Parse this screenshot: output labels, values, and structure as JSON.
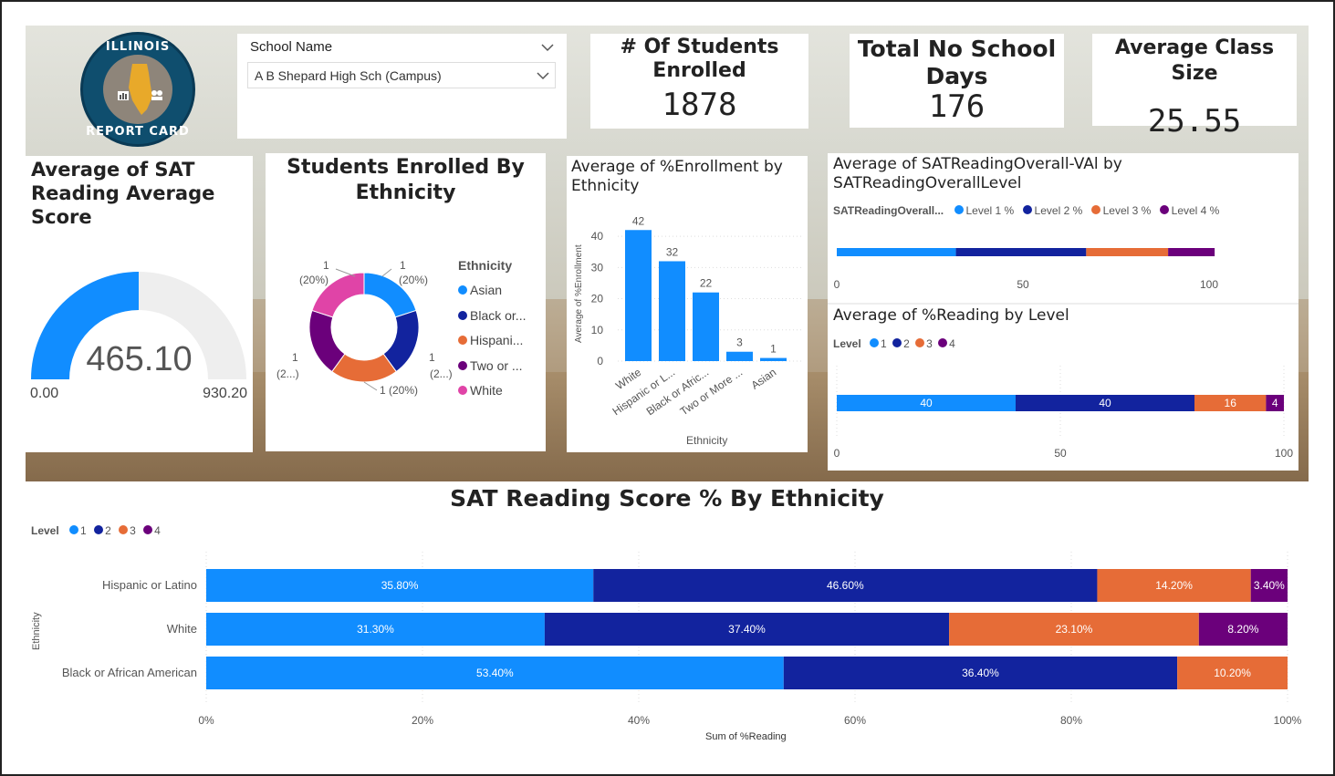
{
  "logo": {
    "top_text": "ILLINOIS",
    "bottom_text": "REPORT CARD"
  },
  "school_filter": {
    "label": "School Name",
    "selected": "A B Shepard High Sch (Campus)"
  },
  "kpis": {
    "students_enrolled": {
      "title_line1": "# Of Students",
      "title_line2": "Enrolled",
      "value": "1878"
    },
    "no_school_days": {
      "title_line1": "Total No School",
      "title_line2": "Days",
      "value": "176"
    },
    "class_size": {
      "title": "Average Class Size",
      "value": "25.55"
    }
  },
  "gauge": {
    "title_line1": "Average of SAT",
    "title_line2": "Reading Average",
    "title_line3": "Score",
    "value_label": "465.10",
    "min_label": "0.00",
    "max_label": "930.20",
    "value": 465.1,
    "min": 0,
    "max": 930.2,
    "color": "#118DFF"
  },
  "donut": {
    "title_line1": "Students Enrolled By",
    "title_line2": "Ethnicity",
    "legend_title": "Ethnicity",
    "legend": [
      "Asian",
      "Black or...",
      "Hispani...",
      "Two or ...",
      "White"
    ],
    "labels": {
      "asian_count": "1",
      "asian_pct": "(20%)",
      "black_count": "1",
      "black_pct": "(2...)",
      "hispanic": "1 (20%)",
      "two_count": "1",
      "two_pct": "(2...)",
      "white_count": "1",
      "white_pct": "(20%)"
    }
  },
  "enroll_chart": {
    "title_line1": "Average of %Enrollment by",
    "title_line2": "Ethnicity",
    "ylabel": "Average of %Enrollment",
    "xlabel": "Ethnicity",
    "tick_labels": [
      "White",
      "Hispanic or L...",
      "Black or Afric...",
      "Two or More ...",
      "Asian"
    ],
    "yticks": [
      "0",
      "10",
      "20",
      "30",
      "40"
    ]
  },
  "sat_overall_chart": {
    "title_line1": "Average of SATReadingOverall-VAl by",
    "title_line2": "SATReadingOverallLevel",
    "legend_title": "SATReadingOverall...",
    "legend": [
      "Level 1 %",
      "Level 2 %",
      "Level 3 %",
      "Level 4 %"
    ],
    "xticks": [
      "0",
      "50",
      "100"
    ]
  },
  "reading_level_chart": {
    "title": "Average of %Reading by Level",
    "legend_title": "Level",
    "legend": [
      "1",
      "2",
      "3",
      "4"
    ],
    "xticks": [
      "0",
      "50",
      "100"
    ],
    "bar_labels": [
      "40",
      "40",
      "16",
      "4"
    ]
  },
  "ethnicity_chart": {
    "title": "SAT Reading Score % By Ethnicity",
    "legend_title": "Level",
    "legend": [
      "1",
      "2",
      "3",
      "4"
    ],
    "ylabel": "Ethnicity",
    "xlabel": "Sum of %Reading",
    "xticks": [
      "0%",
      "20%",
      "40%",
      "60%",
      "80%",
      "100%"
    ]
  },
  "colors": {
    "level1": "#118DFF",
    "level2": "#12239E",
    "level3": "#E66C37",
    "level4": "#6B007B",
    "white_eth": "#E044A7"
  },
  "chart_data": [
    {
      "type": "pie",
      "title": "Students Enrolled By Ethnicity",
      "categories": [
        "Asian",
        "Black or African American",
        "Hispanic or Latino",
        "Two or More Races",
        "White"
      ],
      "values": [
        1,
        1,
        1,
        1,
        1
      ]
    },
    {
      "type": "bar",
      "title": "Average of %Enrollment by Ethnicity",
      "categories": [
        "White",
        "Hispanic or Latino",
        "Black or African American",
        "Two or More Races",
        "Asian"
      ],
      "values": [
        42,
        32,
        22,
        3,
        1
      ],
      "ylim": [
        0,
        45
      ]
    },
    {
      "type": "bar",
      "title": "Average of SATReadingOverall-VAl by SATReadingOverallLevel",
      "series": [
        {
          "name": "Level 1 %",
          "values": [
            32
          ]
        },
        {
          "name": "Level 2 %",
          "values": [
            35
          ]
        },
        {
          "name": "Level 3 %",
          "values": [
            22
          ]
        },
        {
          "name": "Level 4 %",
          "values": [
            12.5
          ]
        }
      ],
      "xlim": [
        0,
        100
      ]
    },
    {
      "type": "bar",
      "title": "Average of %Reading by Level",
      "series": [
        {
          "name": "1",
          "values": [
            40
          ]
        },
        {
          "name": "2",
          "values": [
            40
          ]
        },
        {
          "name": "3",
          "values": [
            16
          ]
        },
        {
          "name": "4",
          "values": [
            4
          ]
        }
      ],
      "xlim": [
        0,
        100
      ]
    },
    {
      "type": "bar",
      "title": "SAT Reading Score % By Ethnicity",
      "categories": [
        "Hispanic or Latino",
        "White",
        "Black or African American"
      ],
      "series": [
        {
          "name": "1",
          "values": [
            35.8,
            31.3,
            53.4
          ]
        },
        {
          "name": "2",
          "values": [
            46.6,
            37.4,
            36.4
          ]
        },
        {
          "name": "3",
          "values": [
            14.2,
            23.1,
            10.2
          ]
        },
        {
          "name": "4",
          "values": [
            3.4,
            8.2,
            0
          ]
        }
      ],
      "value_labels": [
        [
          "35.80%",
          "46.60%",
          "14.20%",
          "3.40%"
        ],
        [
          "31.30%",
          "37.40%",
          "23.10%",
          "8.20%"
        ],
        [
          "53.40%",
          "36.40%",
          "10.20%",
          ""
        ]
      ]
    }
  ]
}
